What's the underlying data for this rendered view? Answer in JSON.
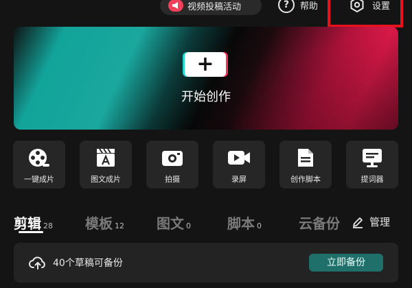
{
  "topbar": {
    "event_label": "视频投稿活动",
    "help_label": "帮助",
    "settings_label": "设置"
  },
  "hero": {
    "start_label": "开始创作"
  },
  "tools": [
    {
      "label": "一键成片",
      "icon": "film-reel-icon"
    },
    {
      "label": "图文成片",
      "icon": "clapper-text-icon"
    },
    {
      "label": "拍摄",
      "icon": "camera-icon"
    },
    {
      "label": "录屏",
      "icon": "video-record-icon"
    },
    {
      "label": "创作脚本",
      "icon": "script-document-icon"
    },
    {
      "label": "提词器",
      "icon": "teleprompter-icon"
    }
  ],
  "tabs": [
    {
      "label": "剪辑",
      "count": "28"
    },
    {
      "label": "模板",
      "count": "12"
    },
    {
      "label": "图文",
      "count": "0"
    },
    {
      "label": "脚本",
      "count": "0"
    },
    {
      "label": "云备份",
      "count": ""
    }
  ],
  "manage_label": "管理",
  "backup": {
    "text": "40个草稿可备份",
    "button_label": "立即备份"
  },
  "colors": {
    "accent_teal": "#1f6f6a",
    "highlight_red": "#e8121c",
    "brand_pink": "#f2315a",
    "brand_cyan": "#21d6d0"
  }
}
